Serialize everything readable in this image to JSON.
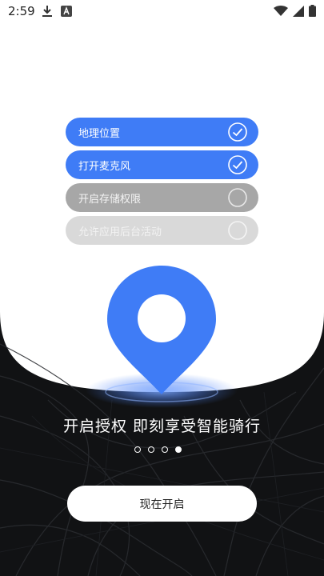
{
  "status_bar": {
    "time": "2:59",
    "icons_left": [
      "download-icon",
      "app-a-icon"
    ],
    "icons_right": [
      "wifi-icon",
      "signal-icon",
      "battery-icon"
    ]
  },
  "permissions": [
    {
      "label": "地理位置",
      "state": "enabled"
    },
    {
      "label": "打开麦克风",
      "state": "enabled"
    },
    {
      "label": "开启存储权限",
      "state": "pending"
    },
    {
      "label": "允许应用后台活动",
      "state": "disabled"
    }
  ],
  "slogan": "开启授权 即刻享受智能骑行",
  "pager": {
    "count": 4,
    "active_index": 3
  },
  "cta_label": "现在开启",
  "colors": {
    "accent": "#3f7cf6",
    "pending": "#a7a7a7",
    "disabled": "#d9d9d9",
    "dark_bg": "#111214"
  }
}
